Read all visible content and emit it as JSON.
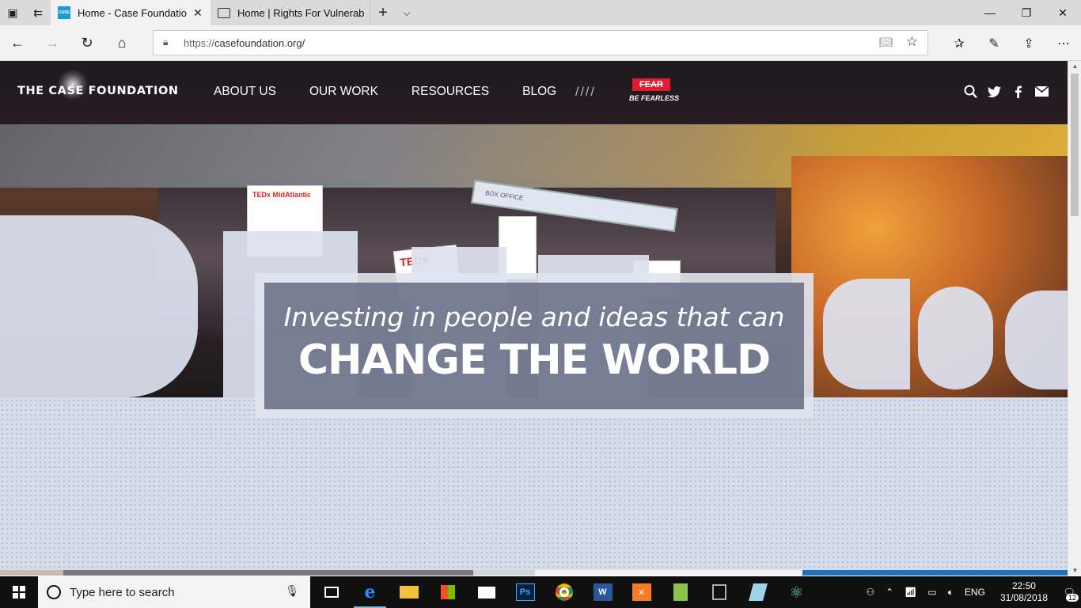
{
  "browser": {
    "tabs": [
      {
        "title": "Home - Case Foundatio",
        "active": true,
        "favicon": "case-foundation-icon"
      },
      {
        "title": "Home | Rights For Vulnerab",
        "active": false,
        "favicon": "page-icon"
      }
    ],
    "url_protocol": "https://",
    "url_host": "casefoundation.org/"
  },
  "site": {
    "logo_text": "THE CASE FOUNDATION",
    "nav": [
      "ABOUT US",
      "OUR WORK",
      "RESOURCES",
      "BLOG"
    ],
    "slashes": "////",
    "fear_badge": "FEAR",
    "fear_tagline": "BE FEARLESS",
    "hero_tagline": "Investing in people and ideas that can",
    "hero_headline": "CHANGE THE WORLD",
    "hero_signs": [
      "TEDx MidAtlantic",
      "TEDx",
      "BOX OFFICE"
    ]
  },
  "taskbar": {
    "search_placeholder": "Type here to search",
    "language": "ENG",
    "time": "22:50",
    "date": "31/08/2018",
    "notification_count": "12"
  },
  "colors": {
    "accent_red": "#e31b2e",
    "taskbar_bg": "#101010",
    "edge_blue": "#1e73be"
  }
}
